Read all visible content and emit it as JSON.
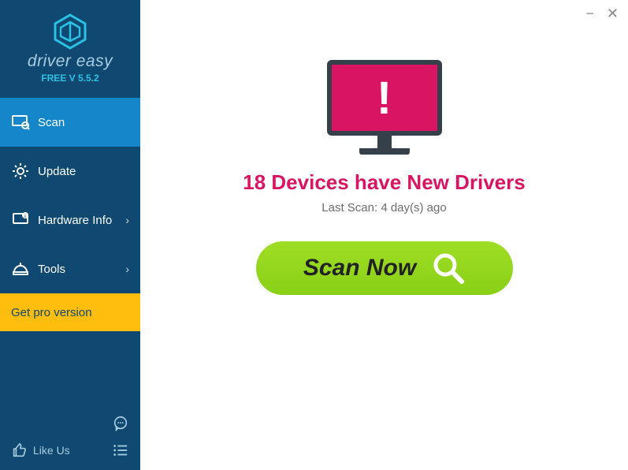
{
  "window": {
    "minimize": "−",
    "close": "✕"
  },
  "branding": {
    "name": "driver easy",
    "version_label": "FREE V 5.5.2"
  },
  "sidebar": {
    "items": [
      {
        "label": "Scan",
        "has_chevron": false
      },
      {
        "label": "Update",
        "has_chevron": false
      },
      {
        "label": "Hardware Info",
        "has_chevron": true
      },
      {
        "label": "Tools",
        "has_chevron": true
      }
    ],
    "pro_label": "Get pro version",
    "like_us_label": "Like Us"
  },
  "main": {
    "status_text": "18 Devices have New Drivers",
    "last_scan_text": "Last Scan: 4 day(s) ago",
    "scan_button_label": "Scan Now"
  },
  "colors": {
    "sidebar_bg": "#0f4870",
    "active_nav": "#1486c9",
    "pro_bg": "#ffbd0d",
    "alert": "#d91563",
    "scan_green": "#94d81d"
  }
}
